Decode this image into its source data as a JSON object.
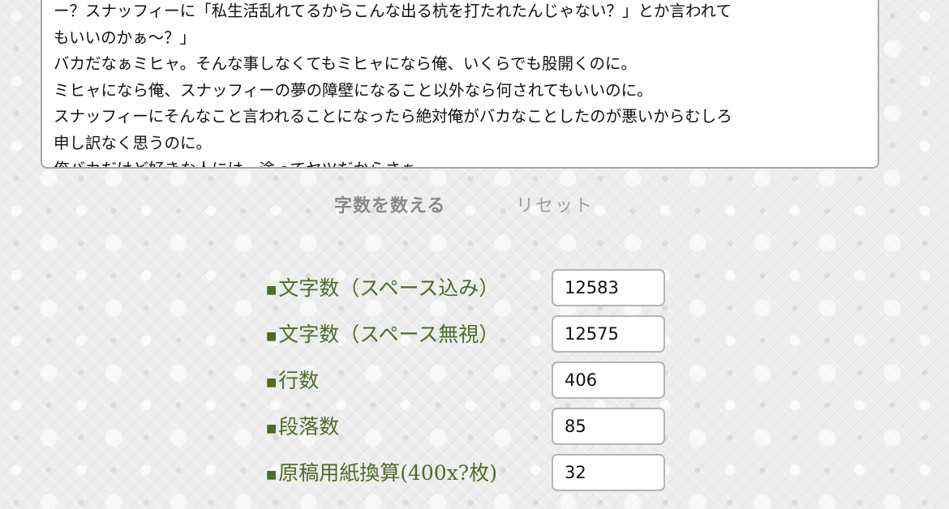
{
  "textarea": {
    "lines": [
      "ー？スナッフィーに「私生活乱れてるからこんな出る杭を打たれたんじゃない？」とか言われて",
      "もいいのかぁ〜？」",
      "バカだなぁミヒャ。そんな事しなくてもミヒャになら俺、いくらでも股開くのに。",
      "ミヒャになら俺、スナッフィーの夢の障壁になること以外なら何されてもいいのに。",
      "スナッフィーにそんなこと言われることになったら絶対俺がバカなことしたのが悪いからむしろ",
      "申し訳なく思うのに。",
      "俺バカだけど好きな人には一途ってヤツだからさぁ。"
    ]
  },
  "buttons": {
    "count_label": "字数を数える",
    "reset_label": "リセット"
  },
  "stats": [
    {
      "label": "文字数（スペース込み）",
      "value": "12583"
    },
    {
      "label": "文字数（スペース無視）",
      "value": "12575"
    },
    {
      "label": "行数",
      "value": "406"
    },
    {
      "label": "段落数",
      "value": "85"
    },
    {
      "label": "原稿用紙換算(400x?枚)",
      "value": "32"
    }
  ],
  "bullet_glyph": "■",
  "colors": {
    "label_green": "#4e6b28",
    "button_gray": "#888888",
    "border_gray": "#b4b4b4"
  }
}
